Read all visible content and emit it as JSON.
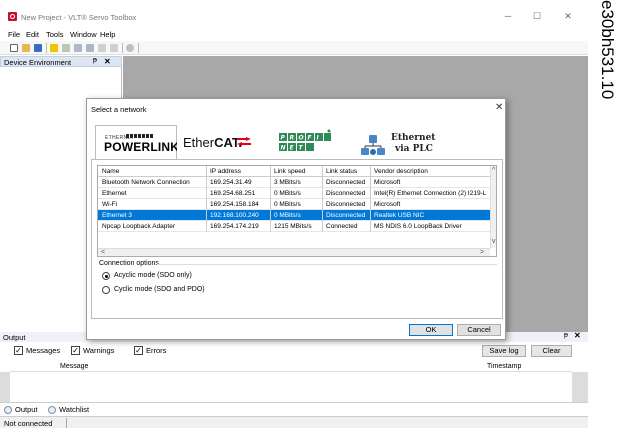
{
  "window": {
    "title": "New Project - VLT® Servo Toolbox",
    "minimize": "─",
    "maximize": "☐",
    "close": "✕"
  },
  "menu": [
    "File",
    "Edit",
    "Tools",
    "Window",
    "Help"
  ],
  "device_panel": {
    "title": "Device Environment",
    "pin": "ᵽ",
    "close": "✕"
  },
  "dialog": {
    "title": "Select a network",
    "close": "✕",
    "network_tabs": {
      "powerlink_small": "ETHERNET",
      "powerlink": "POWERLINK",
      "ethercat_prefix": "Ether",
      "ethercat_bold": "CAT.",
      "profinet": "PROFINET",
      "ethernet_plc_line1": "Ethernet",
      "ethernet_plc_line2": "via PLC"
    },
    "columns": [
      "Name",
      "IP address",
      "Link speed",
      "Link status",
      "Vendor description"
    ],
    "rows": [
      [
        "Bluetooth Network Connection",
        "169.254.31.49",
        "3 MBits/s",
        "Disconnected",
        "Microsoft"
      ],
      [
        "Ethernet",
        "169.254.68.251",
        "0 MBits/s",
        "Disconnected",
        "Intel(R) Ethernet Connection (2) I219-LM"
      ],
      [
        "Wi-Fi",
        "169.254.158.184",
        "0 MBits/s",
        "Disconnected",
        "Microsoft"
      ],
      [
        "Ethernet 3",
        "192.168.100.240",
        "0 MBits/s",
        "Disconnected",
        "Realtek USB NIC"
      ],
      [
        "Npcap Loopback Adapter",
        "169.254.174.219",
        "1215 MBits/s",
        "Connected",
        "MS NDIS 6.0 LoopBack Driver"
      ]
    ],
    "selected_row": 3,
    "connection_options_label": "Connection options",
    "options": [
      "Acyclic mode (SDO only)",
      "Cyclic mode (SDO and PDO)"
    ],
    "selected_option": 0,
    "ok_label": "OK",
    "cancel_label": "Cancel"
  },
  "output": {
    "title": "Output",
    "pin": "ᵽ",
    "close": "✕",
    "filters": [
      "Messages",
      "Warnings",
      "Errors"
    ],
    "save_log": "Save log",
    "clear": "Clear",
    "col_message": "Message",
    "col_timestamp": "Timestamp"
  },
  "bottom_tabs": [
    "Output",
    "Watchlist"
  ],
  "status": "Not connected",
  "side_label": "e30bh531.10",
  "colors": {
    "selection": "#0078d7",
    "brand_red": "#c8102e",
    "workspace": "#a8a8a8"
  }
}
